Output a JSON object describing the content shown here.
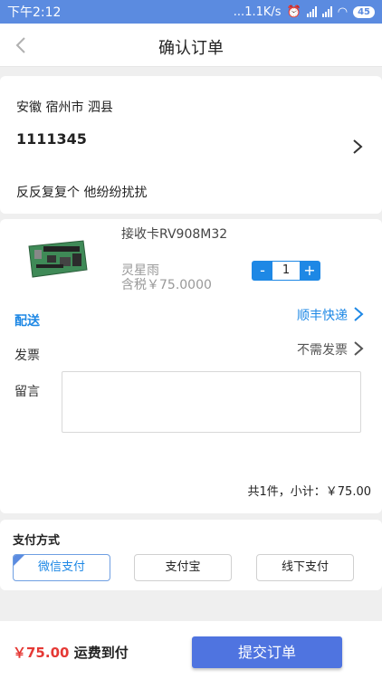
{
  "status_bar": {
    "time": "下午2:12",
    "network_speed": "...1.1K/s",
    "battery": "45"
  },
  "nav": {
    "title": "确认订单",
    "back_icon": "chevron-left-icon"
  },
  "address": {
    "region": "安徽 宿州市 泗县",
    "phone": "1111345",
    "detail": "反反复复个 他纷纷扰扰"
  },
  "product": {
    "name": "接收卡RV908M32",
    "brand": "灵星雨",
    "price": "含税￥75.0000",
    "quantity": "1",
    "minus": "-",
    "plus": "+"
  },
  "delivery": {
    "label": "配送",
    "value": "顺丰快递"
  },
  "invoice": {
    "label": "发票",
    "value": "不需发票"
  },
  "message": {
    "label": "留言",
    "value": ""
  },
  "subtotal": "共1件，小计：￥75.00",
  "payment": {
    "title": "支付方式",
    "options": [
      "微信支付",
      "支付宝",
      "线下支付"
    ],
    "selected": "微信支付"
  },
  "footer": {
    "total": "￥75.00",
    "shipping_note": "运费到付",
    "submit_label": "提交订单"
  },
  "colors": {
    "accent": "#1e88e5",
    "submit": "#4f74e0",
    "price": "#e53935",
    "status_bar": "#5b8be0"
  }
}
